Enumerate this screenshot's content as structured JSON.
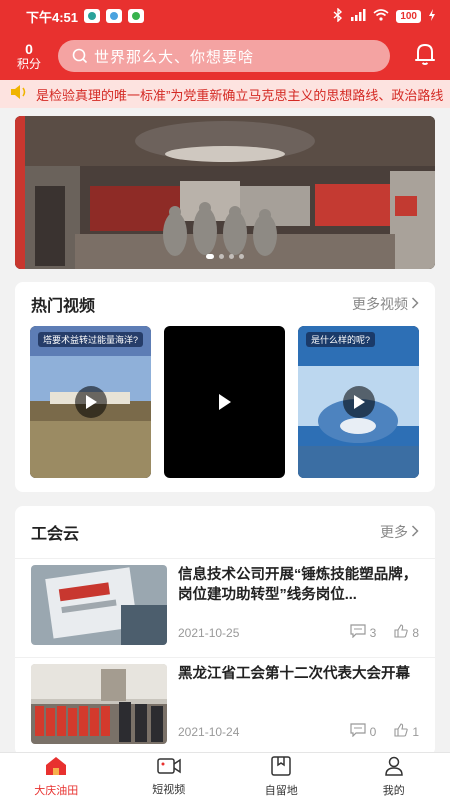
{
  "status": {
    "time": "下午4:51",
    "battery": "100"
  },
  "header": {
    "points_value": "0",
    "points_label": "积分",
    "search_placeholder": "世界那么大、你想要啥"
  },
  "ticker": {
    "text": "是检验真理的唯一标准”为党重新确立马克思主义的思想路线、政治路线"
  },
  "banner": {
    "slide_count": 4,
    "active_slide": 1
  },
  "hot_videos": {
    "title": "热门视频",
    "more": "更多视频",
    "videos": [
      {
        "caption": "塔要术益转过能量海洋?"
      },
      {
        "caption": ""
      },
      {
        "caption": "是什么样的呢?"
      }
    ]
  },
  "union": {
    "title": "工会云",
    "more": "更多",
    "news": [
      {
        "title": "信息技术公司开展“锤炼技能塑品牌，岗位建功助转型”线务岗位...",
        "date": "2021-10-25",
        "comments": "3",
        "likes": "8"
      },
      {
        "title": "黑龙江省工会第十二次代表大会开幕",
        "date": "2021-10-24",
        "comments": "0",
        "likes": "1"
      }
    ]
  },
  "tabbar": {
    "tabs": [
      {
        "label": "大庆油田",
        "icon": "home-icon",
        "active": true
      },
      {
        "label": "短视频",
        "icon": "video-camera-icon",
        "active": false
      },
      {
        "label": "自留地",
        "icon": "bookmark-box-icon",
        "active": false
      },
      {
        "label": "我的",
        "icon": "person-icon",
        "active": false
      }
    ]
  },
  "colors": {
    "brand": "#e8312f",
    "ticker_bg": "#fde3e0"
  }
}
